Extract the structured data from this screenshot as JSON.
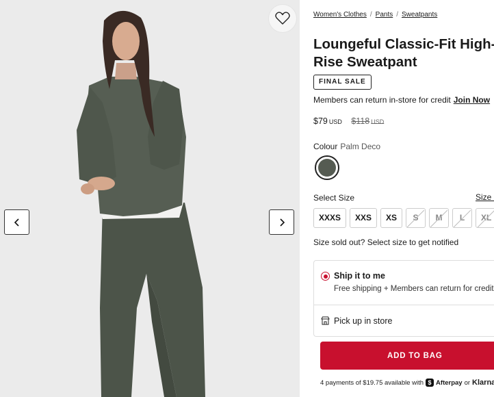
{
  "gallery": {
    "favorite_icon": "heart-outline-icon",
    "prev_icon": "chevron-left-icon",
    "next_icon": "chevron-right-icon"
  },
  "breadcrumb": [
    {
      "label": "Women's Clothes"
    },
    {
      "label": "Pants"
    },
    {
      "label": "Sweatpants"
    }
  ],
  "product": {
    "title": "Loungeful Classic-Fit High-Rise Sweatpant",
    "badge": "FINAL SALE",
    "members_text": "Members can return in-store for credit",
    "join_label": "Join Now",
    "price": {
      "current": "$79",
      "current_currency": "USD",
      "original": "$118",
      "original_currency": "USD"
    },
    "colour": {
      "label": "Colour",
      "name": "Palm Deco",
      "swatch_color": "#555b52"
    }
  },
  "sizes": {
    "label": "Select Size",
    "guide_label": "Size Guide",
    "options": [
      {
        "label": "XXXS",
        "available": true
      },
      {
        "label": "XXS",
        "available": true
      },
      {
        "label": "XS",
        "available": true
      },
      {
        "label": "S",
        "available": false
      },
      {
        "label": "M",
        "available": false
      },
      {
        "label": "L",
        "available": false
      },
      {
        "label": "XL",
        "available": false
      }
    ],
    "sold_out_text": "Size sold out? Select size to get notified"
  },
  "fulfillment": {
    "ship_title": "Ship it to me",
    "ship_subtitle": "Free shipping + Members can return for credit",
    "pickup_label": "Pick up in store",
    "accent_color": "#c8102e"
  },
  "cart": {
    "add_to_bag_label": "ADD TO BAG"
  },
  "payment": {
    "text": "4 payments of $19.75 available with",
    "afterpay_label": "Afterpay",
    "or_label": "or",
    "klarna_label": "Klarna."
  }
}
